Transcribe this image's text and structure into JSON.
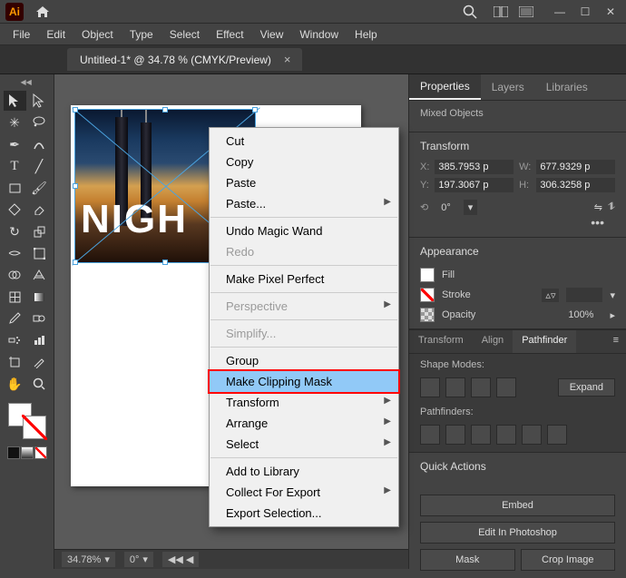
{
  "menubar": {
    "items": [
      "File",
      "Edit",
      "Object",
      "Type",
      "Select",
      "Effect",
      "View",
      "Window",
      "Help"
    ]
  },
  "document": {
    "tab_title": "Untitled-1* @ 34.78 % (CMYK/Preview)"
  },
  "canvas": {
    "text_overlay": "NIGH"
  },
  "context_menu": {
    "cut": "Cut",
    "copy": "Copy",
    "paste": "Paste",
    "paste_sub": "Paste...",
    "undo": "Undo Magic Wand",
    "redo": "Redo",
    "pixel_perfect": "Make Pixel Perfect",
    "perspective": "Perspective",
    "simplify": "Simplify...",
    "group": "Group",
    "clipping": "Make Clipping Mask",
    "transform": "Transform",
    "arrange": "Arrange",
    "select": "Select",
    "add_lib": "Add to Library",
    "collect": "Collect For Export",
    "export_sel": "Export Selection..."
  },
  "properties": {
    "tabs": {
      "properties": "Properties",
      "layers": "Layers",
      "libraries": "Libraries"
    },
    "object_summary": "Mixed Objects",
    "transform": {
      "heading": "Transform",
      "x_label": "X:",
      "x": "385.7953 p",
      "y_label": "Y:",
      "y": "197.3067 p",
      "w_label": "W:",
      "w": "677.9329 p",
      "h_label": "H:",
      "h": "306.3258 p",
      "angle": "0°"
    },
    "appearance": {
      "heading": "Appearance",
      "fill": "Fill",
      "stroke": "Stroke",
      "opacity_label": "Opacity",
      "opacity": "100%"
    }
  },
  "pathfinder": {
    "tabs": {
      "transform": "Transform",
      "align": "Align",
      "pathfinder": "Pathfinder"
    },
    "shape_modes": "Shape Modes:",
    "expand": "Expand",
    "pathfinders": "Pathfinders:"
  },
  "quick_actions": {
    "heading": "Quick Actions",
    "embed": "Embed",
    "edit_ps": "Edit In Photoshop",
    "mask": "Mask",
    "crop": "Crop Image"
  },
  "status": {
    "zoom": "34.78%",
    "rotation": "0°"
  }
}
